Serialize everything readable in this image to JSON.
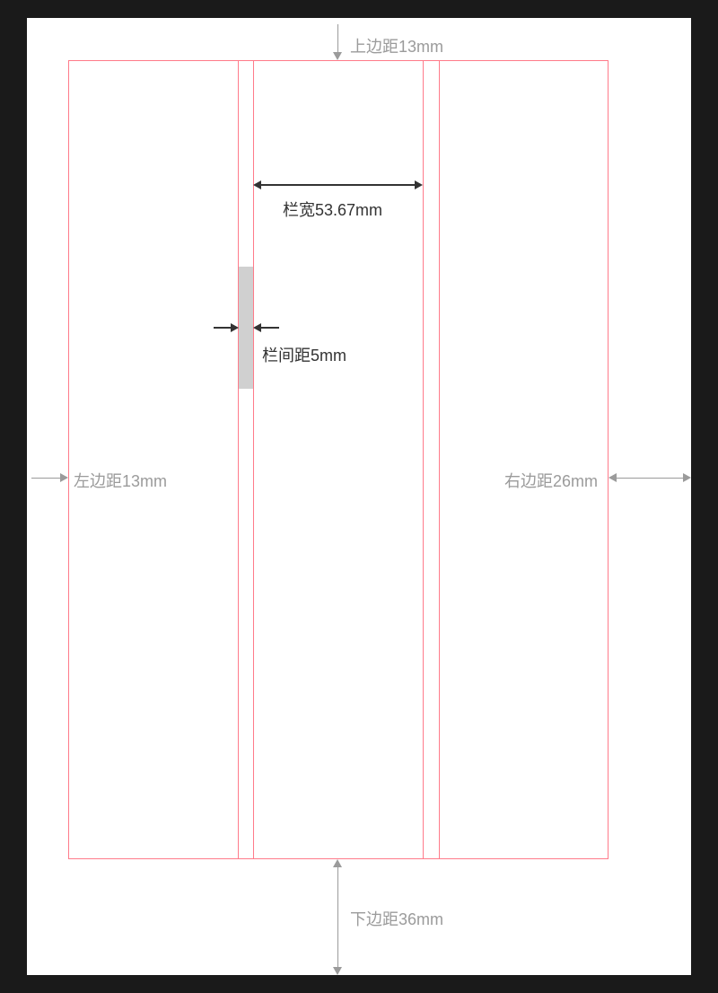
{
  "labels": {
    "top_margin": "上边距13mm",
    "left_margin": "左边距13mm",
    "right_margin": "右边距26mm",
    "bottom_margin": "下边距36mm",
    "column_width": "栏宽53.67mm",
    "gutter": "栏间距5mm"
  },
  "layout": {
    "page_width_mm": 210,
    "page_height_mm": 297,
    "top_margin_mm": 13,
    "left_margin_mm": 13,
    "right_margin_mm": 26,
    "bottom_margin_mm": 36,
    "columns": 3,
    "column_width_mm": 53.67,
    "gutter_mm": 5
  },
  "colors": {
    "guide": "#ff7b8a",
    "label_grey": "#9b9b9b",
    "label_dark": "#333333",
    "gutter_highlight": "#d0d0d0",
    "page_bg": "#ffffff",
    "canvas_bg": "#1a1a1a"
  }
}
